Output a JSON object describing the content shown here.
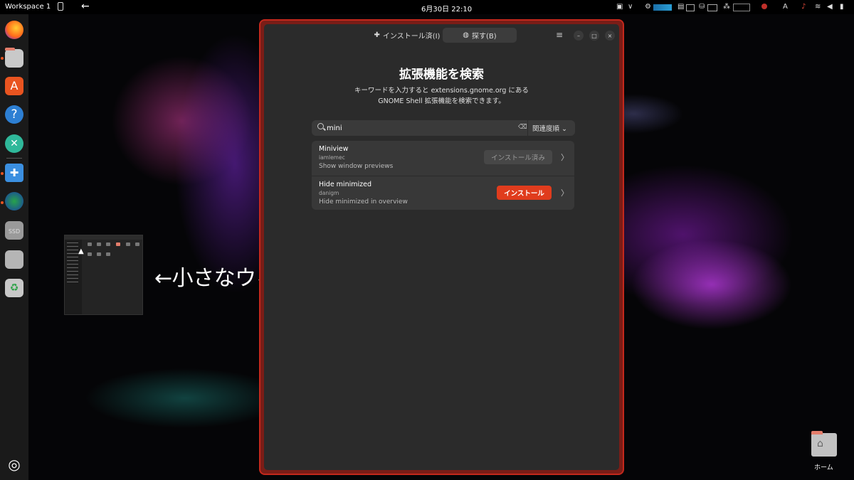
{
  "topbar": {
    "workspace": "Workspace 1",
    "clock": "6月30日  22:10",
    "input_source": "A"
  },
  "dock": {
    "items": [
      {
        "name": "firefox",
        "icon": "firefox-icon"
      },
      {
        "name": "files",
        "icon": "files-icon"
      },
      {
        "name": "app-center",
        "icon": "app-center-icon"
      },
      {
        "name": "help",
        "icon": "help-icon"
      },
      {
        "name": "remote-desktop",
        "icon": "remote-desktop-icon"
      },
      {
        "name": "extension-manager",
        "icon": "puzzle-icon"
      },
      {
        "name": "web",
        "icon": "globe-icon"
      },
      {
        "name": "ssd-drive",
        "icon": "ssd-icon",
        "label": "SSD"
      },
      {
        "name": "sd-card",
        "icon": "sd-card-icon"
      },
      {
        "name": "trash",
        "icon": "trash-icon"
      }
    ],
    "apps_button": "ubuntu-logo-icon"
  },
  "annotation": "←小さなウィンドウで表示されます",
  "window": {
    "tabs": [
      {
        "label": "インストール済(I)",
        "icon": "puzzle-icon",
        "active": false
      },
      {
        "label": "探す(B)",
        "icon": "globe-icon",
        "active": true
      }
    ],
    "menu_icon": "hamburger-icon",
    "controls": [
      "minimize-icon",
      "maximize-icon",
      "close-icon"
    ],
    "title": "拡張機能を検索",
    "description_line1": "キーワードを入力すると extensions.gnome.org にある",
    "description_line2": "GNOME Shell 拡張機能を検索できます。",
    "search": {
      "value": "mini",
      "placeholder": ""
    },
    "sort": {
      "label": "関連度順",
      "icon": "chevron-down-icon"
    },
    "results": [
      {
        "name": "Miniview",
        "author": "iamlemec",
        "summary": "Show window previews",
        "button": "インストール済み",
        "button_state": "disabled"
      },
      {
        "name": "Hide minimized",
        "author": "danigm",
        "summary": "Hide minimized in overview",
        "button": "インストール",
        "button_state": "primary"
      }
    ]
  },
  "desktop": {
    "home_label": "ホーム"
  },
  "colors": {
    "accent": "#e03c1d",
    "window_border": "#c4281c",
    "surface": "#2b2b2b",
    "card": "#383838"
  }
}
